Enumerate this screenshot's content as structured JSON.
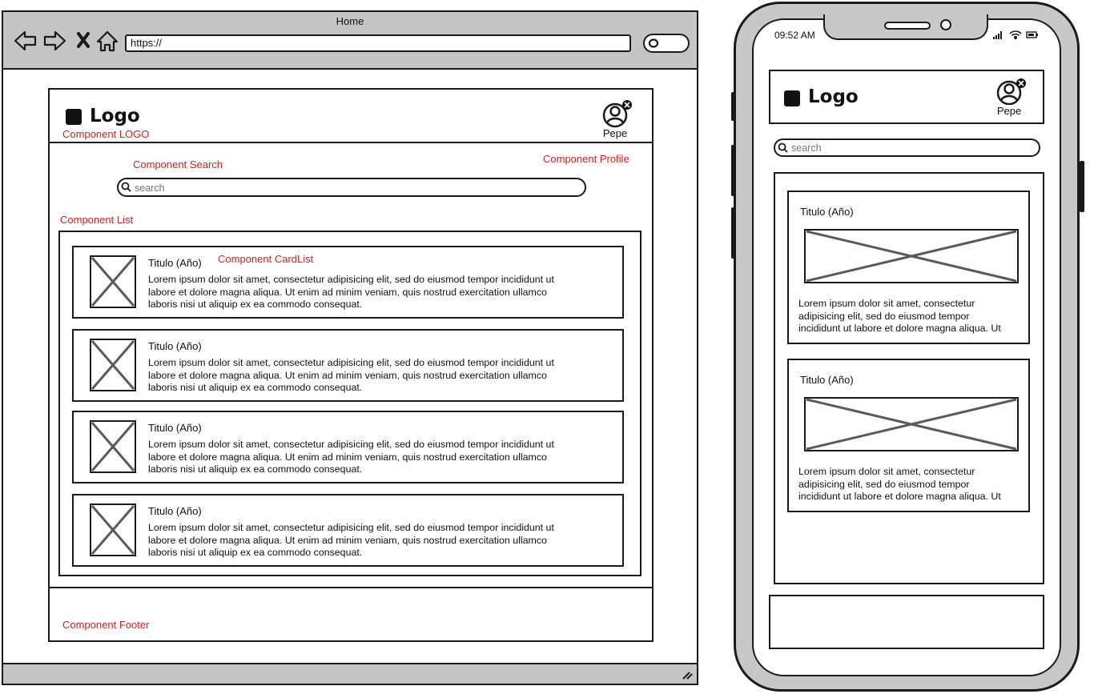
{
  "desktop": {
    "window_title": "Home",
    "url": "https://",
    "header": {
      "logo": "Logo",
      "user_name": "Pepe"
    },
    "annotations": {
      "logo": "Component LOGO",
      "search": "Component Search",
      "profile": "Component Profile",
      "list": "Component List",
      "cardlist": "Component CardList",
      "footer": "Component Footer"
    },
    "search": {
      "placeholder": "search"
    },
    "cards": [
      {
        "title": "Titulo (Año)",
        "lines": [
          "Lorem ipsum dolor sit amet, consectetur adipisicing elit, sed do eiusmod tempor incididunt ut",
          "labore et dolore magna aliqua. Ut enim ad minim veniam, quis nostrud exercitation ullamco",
          "laboris nisi ut aliquip ex ea commodo consequat."
        ]
      },
      {
        "title": "Titulo (Año)",
        "lines": [
          "Lorem ipsum dolor sit amet, consectetur adipisicing elit, sed do eiusmod tempor incididunt ut",
          "labore et dolore magna aliqua. Ut enim ad minim veniam, quis nostrud exercitation ullamco",
          "laboris nisi ut aliquip ex ea commodo consequat."
        ]
      },
      {
        "title": "Titulo (Año)",
        "lines": [
          "Lorem ipsum dolor sit amet, consectetur adipisicing elit, sed do eiusmod tempor incididunt ut",
          "labore et dolore magna aliqua. Ut enim ad minim veniam, quis nostrud exercitation ullamco",
          "laboris nisi ut aliquip ex ea commodo consequat."
        ]
      },
      {
        "title": "Titulo (Año)",
        "lines": [
          "Lorem ipsum dolor sit amet, consectetur adipisicing elit, sed do eiusmod tempor incididunt ut",
          "labore et dolore magna aliqua. Ut enim ad minim veniam, quis nostrud exercitation ullamco",
          "laboris nisi ut aliquip ex ea commodo consequat."
        ]
      }
    ]
  },
  "mobile": {
    "status_time": "09:52 AM",
    "header": {
      "logo": "Logo",
      "user_name": "Pepe"
    },
    "search": {
      "placeholder": "search"
    },
    "cards": [
      {
        "title": "Titulo (Año)",
        "lines": [
          "Lorem ipsum dolor sit amet, consectetur",
          "adipisicing elit, sed do eiusmod tempor",
          "incididunt ut labore et dolore magna aliqua. Ut"
        ]
      },
      {
        "title": "Titulo (Año)",
        "lines": [
          "Lorem ipsum dolor sit amet, consectetur",
          "adipisicing elit, sed do eiusmod tempor",
          "incididunt ut labore et dolore magna aliqua. Ut"
        ]
      }
    ]
  },
  "colors": {
    "annotation": "#d21f1f",
    "chrome": "#c4c4c4",
    "ink": "#1a1a1a",
    "placeholder_x": "#5a5a5a"
  },
  "icons": [
    "back-arrow-icon",
    "forward-arrow-icon",
    "close-x-icon",
    "home-icon",
    "search-icon",
    "user-avatar-icon",
    "close-badge-icon",
    "image-placeholder-icon",
    "signal-icon",
    "wifi-icon",
    "battery-icon",
    "resize-grip-icon"
  ]
}
